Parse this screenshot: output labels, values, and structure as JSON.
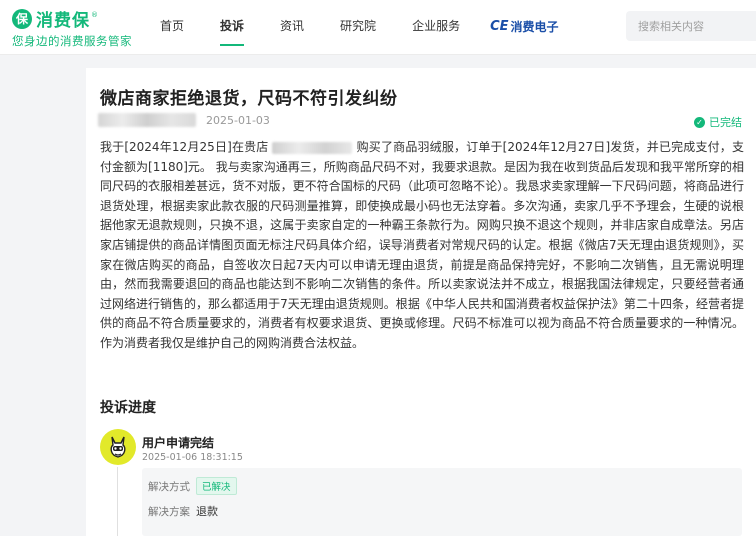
{
  "brand": {
    "name": "消费保",
    "slogan": "您身边的消费服务管家",
    "reg_mark": "®",
    "mark_glyph": "保",
    "color": "#13b87a"
  },
  "nav": {
    "items": [
      {
        "label": "首页",
        "active": false
      },
      {
        "label": "投诉",
        "active": true
      },
      {
        "label": "资讯",
        "active": false
      },
      {
        "label": "研究院",
        "active": false
      },
      {
        "label": "企业服务",
        "active": false
      }
    ],
    "partner": {
      "prefix": "CE",
      "label": "消费电子"
    }
  },
  "search": {
    "placeholder": "搜索相关内容"
  },
  "complaint": {
    "title": "微店商家拒绝退货，尺码不符引发纠纷",
    "date": "2025-01-03",
    "status": "已完结",
    "body_part1": "我于[2024年12月25日]在贵店",
    "body_part2": "购买了商品羽绒服，订单于[2024年12月27日]发货，并已完成支付，支付金额为[1180]元。 我与卖家沟通再三，所购商品尺码不对，我要求退款。是因为我在收到货品后发现和我平常所穿的相同尺码的衣服相差甚远，货不对版，更不符合国标的尺码（此项可忽略不论）。我恳求卖家理解一下尺码问题，将商品进行退货处理，根据卖家此款衣服的尺码测量推算，即使换成最小码也无法穿着。多次沟通，卖家几乎不予理会，生硬的说根据他家无退款规则，只换不退，这属于卖家自定的一种霸王条款行为。网购只换不退这个规则，并非店家自成章法。另店家店铺提供的商品详情图页面无标注尺码具体介绍，误导消费者对常规尺码的认定。根据《微店7天无理由退货规则》，买家在微店购买的商品，自签收次日起7天内可以申请无理由退货，前提是商品保持完好，不影响二次销售，且无需说明理由，然而我需要退回的商品也能达到不影响二次销售的条件。所以卖家说法并不成立，根据我国法律规定，只要经营者通过网络进行销售的，那么都适用于7天无理由退货规则。根据《中华人民共和国消费者权益保护法》第二十四条，经营者提供的商品不符合质量要求的，消费者有权要求退货、更换或修理。尺码不标准可以视为商品不符合质量要求的一种情况。作为消费者我仅是维护自己的网购消费合法权益。"
  },
  "progress": {
    "title": "投诉进度",
    "steps": [
      {
        "title": "用户申请完结",
        "time": "2025-01-06 18:31:15",
        "method_label": "解决方式",
        "method_badge": "已解决",
        "plan_label": "解决方案",
        "plan_value": "退款"
      }
    ]
  }
}
